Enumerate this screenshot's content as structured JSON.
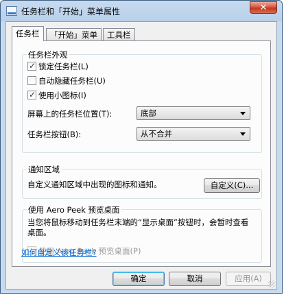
{
  "window": {
    "title": "任务栏和「开始」菜单属性",
    "close_label": "✕"
  },
  "tabs": [
    {
      "label": "任务栏",
      "active": true
    },
    {
      "label": "「开始」菜单",
      "active": false
    },
    {
      "label": "工具栏",
      "active": false
    }
  ],
  "appearance": {
    "title": "任务栏外观",
    "lock_taskbar": {
      "label": "锁定任务栏(L)",
      "checked": true
    },
    "auto_hide": {
      "label": "自动隐藏任务栏(U)",
      "checked": false
    },
    "small_icons": {
      "label": "使用小图标(I)",
      "checked": true
    },
    "location_label": "屏幕上的任务栏位置(T):",
    "location_value": "底部",
    "buttons_label": "任务栏按钮(B):",
    "buttons_value": "从不合并"
  },
  "notification": {
    "title": "通知区域",
    "description": "自定义通知区域中出现的图标和通知。",
    "customize_button": "自定义(C)..."
  },
  "aero_peek": {
    "title": "使用 Aero Peek 预览桌面",
    "description": "当您将鼠标移动到任务栏末端的“显示桌面”按钮时，会暂时查看桌面。",
    "checkbox_label": "使用 Aero Peek 预览桌面(P)",
    "checked": false
  },
  "help_link": "如何自定义该任务栏?",
  "buttons": {
    "ok": "确定",
    "cancel": "取消",
    "apply": "应用(A)"
  }
}
